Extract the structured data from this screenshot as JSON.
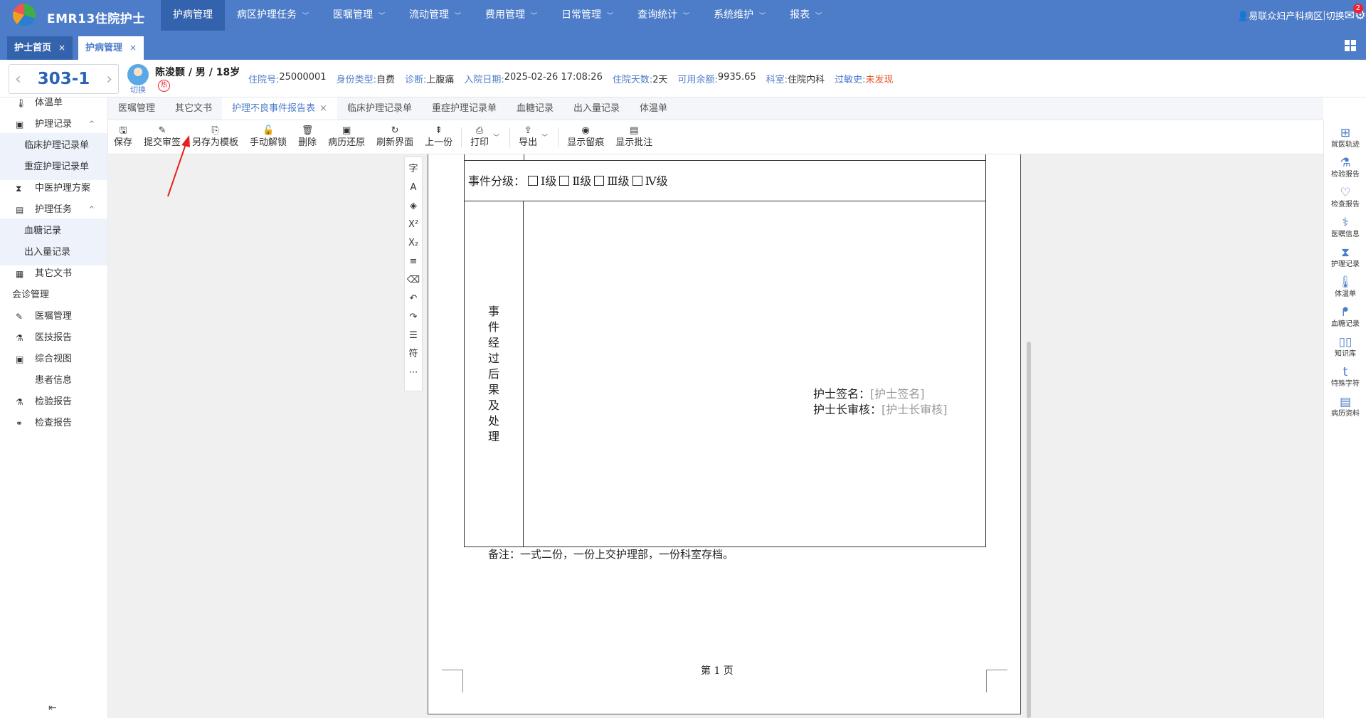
{
  "app": {
    "title": "EMR13住院护士"
  },
  "nav": {
    "items": [
      {
        "label": "护病管理",
        "active": true,
        "dropdown": false
      },
      {
        "label": "病区护理任务",
        "dropdown": true
      },
      {
        "label": "医嘱管理",
        "dropdown": true
      },
      {
        "label": "流动管理",
        "dropdown": true
      },
      {
        "label": "费用管理",
        "dropdown": true
      },
      {
        "label": "日常管理",
        "dropdown": true
      },
      {
        "label": "查询统计",
        "dropdown": true
      },
      {
        "label": "系统维护",
        "dropdown": true
      },
      {
        "label": "报表",
        "dropdown": true
      }
    ]
  },
  "user": {
    "name": "易联众",
    "ward": "妇产科病区",
    "sep": "|",
    "switch": "切换",
    "mail_count": "2"
  },
  "page_tabs": [
    {
      "label": "护士首页",
      "close": "×"
    },
    {
      "label": "护病管理",
      "close": "×"
    }
  ],
  "patient": {
    "bed": "303-1",
    "name_line": "陈浚颢 / 男 / 18岁",
    "switch": "切换",
    "hot": "热",
    "fields": [
      {
        "key": "住院号:",
        "value": "25000001"
      },
      {
        "key": "身份类型:",
        "value": "自费"
      },
      {
        "key": "诊断:",
        "value": "上腹痛"
      },
      {
        "key": "入院日期:",
        "value": "2025-02-26 17:08:26"
      },
      {
        "key": "住院天数:",
        "value": "2天"
      },
      {
        "key": "可用余额:",
        "value": "9935.65"
      },
      {
        "key": "科室:",
        "value": "住院内科"
      },
      {
        "key": "过敏史:",
        "value": "未发现",
        "alert": true
      }
    ]
  },
  "sidebar": {
    "items": [
      {
        "label": "体温单",
        "icon": "thermometer-icon",
        "glyph": "🌡"
      },
      {
        "label": "护理记录",
        "icon": "clipboard-icon",
        "glyph": "▣",
        "arrow": "^"
      },
      {
        "label": "临床护理记录单",
        "sub": true
      },
      {
        "label": "重症护理记录单",
        "sub": true
      },
      {
        "label": "中医护理方案",
        "icon": "hourglass-icon",
        "glyph": "⧗"
      },
      {
        "label": "护理任务",
        "icon": "calendar-icon",
        "glyph": "▤",
        "arrow": "^"
      },
      {
        "label": "血糖记录",
        "sub": true
      },
      {
        "label": "出入量记录",
        "sub": true
      },
      {
        "label": "其它文书",
        "icon": "document-icon",
        "glyph": "▦"
      },
      {
        "label": "会诊管理",
        "plain": true
      },
      {
        "label": "医嘱管理",
        "icon": "edit-icon",
        "glyph": "✎"
      },
      {
        "label": "医技报告",
        "icon": "flask-icon",
        "glyph": "⚗"
      },
      {
        "label": "综合视图",
        "icon": "overview-icon",
        "glyph": "▣"
      },
      {
        "label": "患者信息",
        "icon": "",
        "glyph": ""
      },
      {
        "label": "检验报告",
        "icon": "flask-icon",
        "glyph": "⚗"
      },
      {
        "label": "检查报告",
        "icon": "binoculars-icon",
        "glyph": "⚭"
      }
    ],
    "collapse_glyph": "⇤"
  },
  "doc_tabs": [
    {
      "label": "医嘱管理"
    },
    {
      "label": "其它文书"
    },
    {
      "label": "护理不良事件报告表",
      "active": true,
      "close": "×"
    },
    {
      "label": "临床护理记录单"
    },
    {
      "label": "重症护理记录单"
    },
    {
      "label": "血糖记录"
    },
    {
      "label": "出入量记录"
    },
    {
      "label": "体温单"
    }
  ],
  "toolbar": {
    "save": "保存",
    "submit": "提交审签",
    "save_template": "另存为模板",
    "unlock": "手动解锁",
    "delete": "删除",
    "restore": "病历还原",
    "refresh": "刷新界面",
    "prev": "上一份",
    "print": "打印",
    "export": "导出",
    "show_marks": "显示留痕",
    "show_comments": "显示批注"
  },
  "format_tools": [
    "字",
    "A",
    "◈",
    "X²",
    "X₂",
    "≡",
    "⌫",
    "↶",
    "↷",
    "☰",
    "符",
    "⋯"
  ],
  "form": {
    "grade_label": "事件分级：",
    "grades": [
      "Ⅰ级",
      "Ⅱ级",
      "Ⅲ级",
      "Ⅳ级"
    ],
    "process_label": "事件经过后果及处理",
    "nurse_sign_label": "护士签名：",
    "nurse_sign_ph": "[护士签名]",
    "head_review_label": "护士长审核：",
    "head_review_ph": "[护士长审核]",
    "note": "备注：一式二份，一份上交护理部，一份科室存档。",
    "page": "第  1  页"
  },
  "right_tools": [
    {
      "label": "就医轨迹",
      "icon": "trace-icon",
      "glyph": "⊞"
    },
    {
      "label": "检验报告",
      "icon": "flask-icon",
      "glyph": "⚗"
    },
    {
      "label": "检查报告",
      "icon": "heart-icon",
      "glyph": "♡"
    },
    {
      "label": "医嘱信息",
      "icon": "stethoscope-icon",
      "glyph": "⚕"
    },
    {
      "label": "护理记录",
      "icon": "nurse-icon",
      "glyph": "⧗"
    },
    {
      "label": "体温单",
      "icon": "thermometer-icon",
      "glyph": "🌡"
    },
    {
      "label": "血糖记录",
      "icon": "glucose-icon",
      "glyph": "ᖰ"
    },
    {
      "label": "知识库",
      "icon": "book-icon",
      "glyph": "▯▯"
    },
    {
      "label": "特殊字符",
      "icon": "special-char-icon",
      "glyph": "t"
    },
    {
      "label": "病历资料",
      "icon": "clipboard-icon",
      "glyph": "▤"
    }
  ]
}
